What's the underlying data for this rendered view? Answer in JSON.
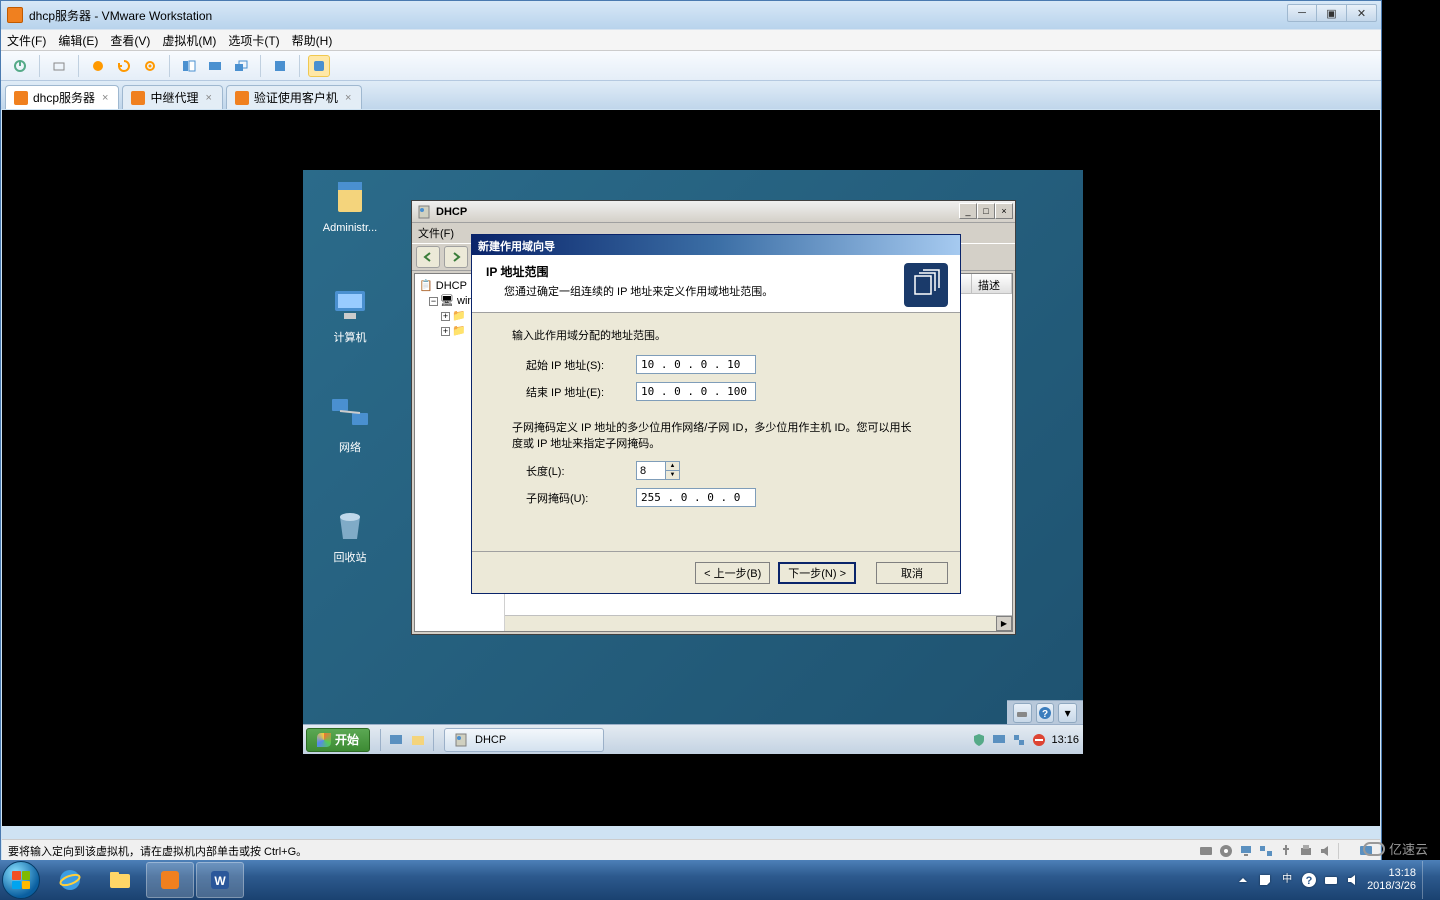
{
  "host": {
    "window_title": "dhcp服务器 - VMware Workstation",
    "menu": [
      "文件(F)",
      "编辑(E)",
      "查看(V)",
      "虚拟机(M)",
      "选项卡(T)",
      "帮助(H)"
    ],
    "tabs": [
      {
        "label": "dhcp服务器",
        "active": true
      },
      {
        "label": "中继代理",
        "active": false
      },
      {
        "label": "验证使用客户机",
        "active": false
      }
    ],
    "statusbar_text": "要将输入定向到该虚拟机，请在虚拟机内部单击或按 Ctrl+G。",
    "taskbar": {
      "time": "13:18",
      "date": "2018/3/26"
    }
  },
  "guest": {
    "desktop_icons": [
      {
        "label": "Administr..."
      },
      {
        "label": "计算机"
      },
      {
        "label": "网络"
      },
      {
        "label": "回收站"
      }
    ],
    "start_label": "开始",
    "task_button": "DHCP",
    "systray_time": "13:16",
    "mmc": {
      "title": "DHCP",
      "file_menu": "文件(F)",
      "tree_root": "DHCP",
      "tree_server": "win",
      "list_header": "描述"
    },
    "wizard": {
      "title": "新建作用域向导",
      "header": "IP 地址范围",
      "subtitle": "您通过确定一组连续的 IP 地址来定义作用域地址范围。",
      "intro": "输入此作用域分配的地址范围。",
      "start_ip_label": "起始 IP 地址(S):",
      "start_ip": "10 . 0 . 0 . 10",
      "end_ip_label": "结束 IP 地址(E):",
      "end_ip": "10 . 0 . 0 . 100",
      "desc": "子网掩码定义 IP 地址的多少位用作网络/子网 ID，多少位用作主机 ID。您可以用长度或 IP 地址来指定子网掩码。",
      "length_label": "长度(L):",
      "length": "8",
      "mask_label": "子网掩码(U):",
      "mask": "255 . 0 . 0 . 0",
      "back": "< 上一步(B)",
      "next": "下一步(N) >",
      "cancel": "取消"
    }
  },
  "watermark": "亿速云"
}
